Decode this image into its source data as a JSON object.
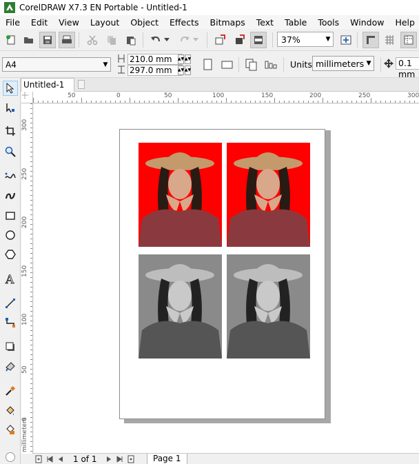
{
  "window": {
    "title": "CorelDRAW X7.3 EN Portable - Untitled-1"
  },
  "menu": {
    "items": [
      "File",
      "Edit",
      "View",
      "Layout",
      "Object",
      "Effects",
      "Bitmaps",
      "Text",
      "Table",
      "Tools",
      "Window",
      "Help"
    ]
  },
  "toolbar": {
    "zoom": "37%"
  },
  "property_bar": {
    "paper_size": "A4",
    "width": "210.0 mm",
    "height": "297.0 mm",
    "units_label": "Units:",
    "units_value": "millimeters",
    "nudge_value": "0.1 mm"
  },
  "document": {
    "tab_label": "Untitled-1"
  },
  "rulers": {
    "horizontal_labels": [
      "50",
      "0",
      "50",
      "100",
      "150",
      "200",
      "250",
      "300"
    ],
    "vertical_labels": [
      "300",
      "250",
      "200",
      "150",
      "100",
      "50",
      "0"
    ],
    "vertical_unit": "millimeters"
  },
  "page_content": {
    "photos": [
      {
        "background": "#ff0000",
        "mode": "color"
      },
      {
        "background": "#ff0000",
        "mode": "color"
      },
      {
        "background": "#8a8a8a",
        "mode": "grayscale"
      },
      {
        "background": "#8a8a8a",
        "mode": "grayscale"
      }
    ]
  },
  "status": {
    "page_count": "1 of 1",
    "page_tab": "Page 1"
  },
  "colors": {
    "accent_selection": "#dfeefc",
    "photo_red": "#ff0000"
  }
}
